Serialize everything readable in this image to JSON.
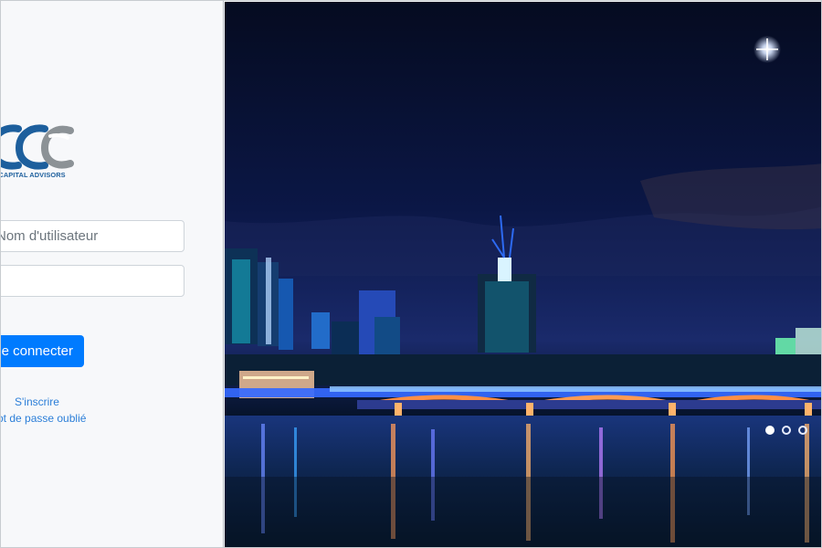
{
  "brand": {
    "name": "ASTIR CAPITAL ADVISORS",
    "visible_name_text": "STIR CAPITAL ADVISORS",
    "primary_color": "#1d5f9d",
    "secondary_color": "#8c9296"
  },
  "login": {
    "username_placeholder": "Nom d'utilisateur",
    "username_value": "",
    "password_placeholder": "",
    "password_value": "",
    "button_label": "Se connecter",
    "signup_link": "S'inscrire",
    "forgot_password_link": "Mot de passe oublié"
  },
  "carousel": {
    "indicators": [
      {
        "icon": "carousel-dot-icon",
        "active": true
      },
      {
        "icon": "carousel-dot-icon",
        "active": false
      },
      {
        "icon": "carousel-dot-icon",
        "active": false
      }
    ]
  },
  "colors": {
    "panel_background": "#f7f8fa",
    "button_blue": "#007bff",
    "link_blue": "#2b7ed8",
    "night_sky": "#07102c",
    "river_blue": "#0d2d62"
  }
}
